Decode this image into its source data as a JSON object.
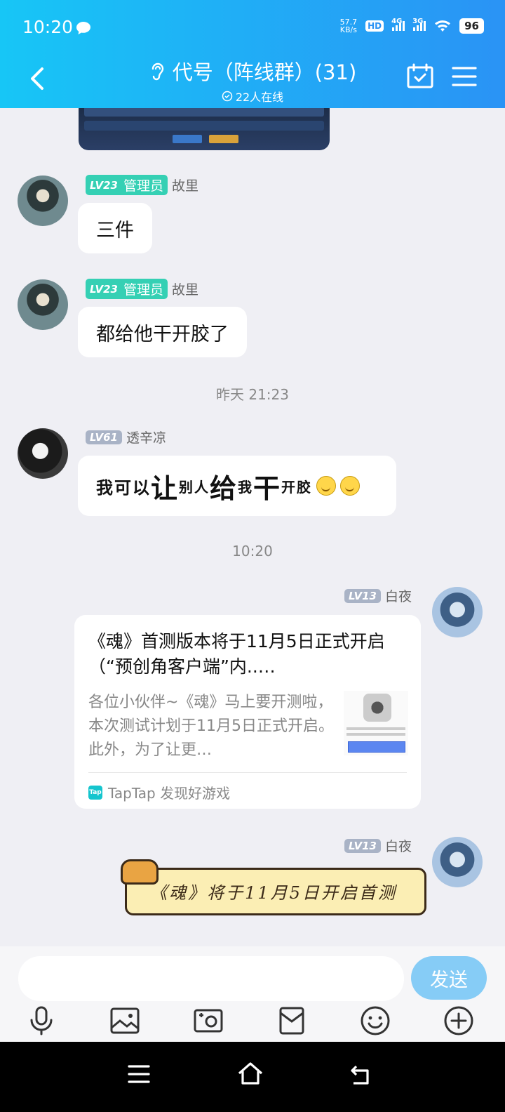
{
  "status_bar": {
    "time": "10:20",
    "net_speed_value": "57.7",
    "net_speed_unit": "KB/s",
    "hd_label": "HD",
    "hd_sub": "1",
    "net_4g": "4G",
    "net_3g": "3G",
    "battery": "96"
  },
  "header": {
    "title": "代号（阵线群）(31)",
    "online": "22人在线"
  },
  "messages": [
    {
      "level": "LV23",
      "role": "管理员",
      "name": "故里",
      "text": "三件"
    },
    {
      "level": "LV23",
      "role": "管理员",
      "name": "故里",
      "text": "都给他干开胶了"
    },
    {
      "timestamp": "昨天 21:23"
    },
    {
      "level": "LV61",
      "name": "透辛凉",
      "text_parts": [
        "我可以",
        "让",
        "别人",
        "给",
        "我",
        "干",
        "开胶"
      ]
    },
    {
      "timestamp": "10:20"
    },
    {
      "level": "LV13",
      "name": "白夜",
      "card": {
        "title": "《魂》首测版本将于11月5日正式开启（“预创角客户端”内..…",
        "desc": "各位小伙伴~《魂》马上要开测啦，本次测试计划于11月5日正式开启。此外，为了让更…",
        "source_logo": "Tap",
        "source": "TapTap 发现好游戏"
      }
    },
    {
      "level": "LV13",
      "name": "白夜",
      "sticker_text": "《魂》将于11月5日开启首测"
    }
  ],
  "input": {
    "placeholder": "",
    "send_label": "发送"
  },
  "toolbar": [
    "microphone-icon",
    "photo-icon",
    "camera-icon",
    "red-packet-icon",
    "emoji-icon",
    "plus-icon"
  ],
  "system_nav": [
    "menu-icon",
    "home-icon",
    "back-icon"
  ]
}
